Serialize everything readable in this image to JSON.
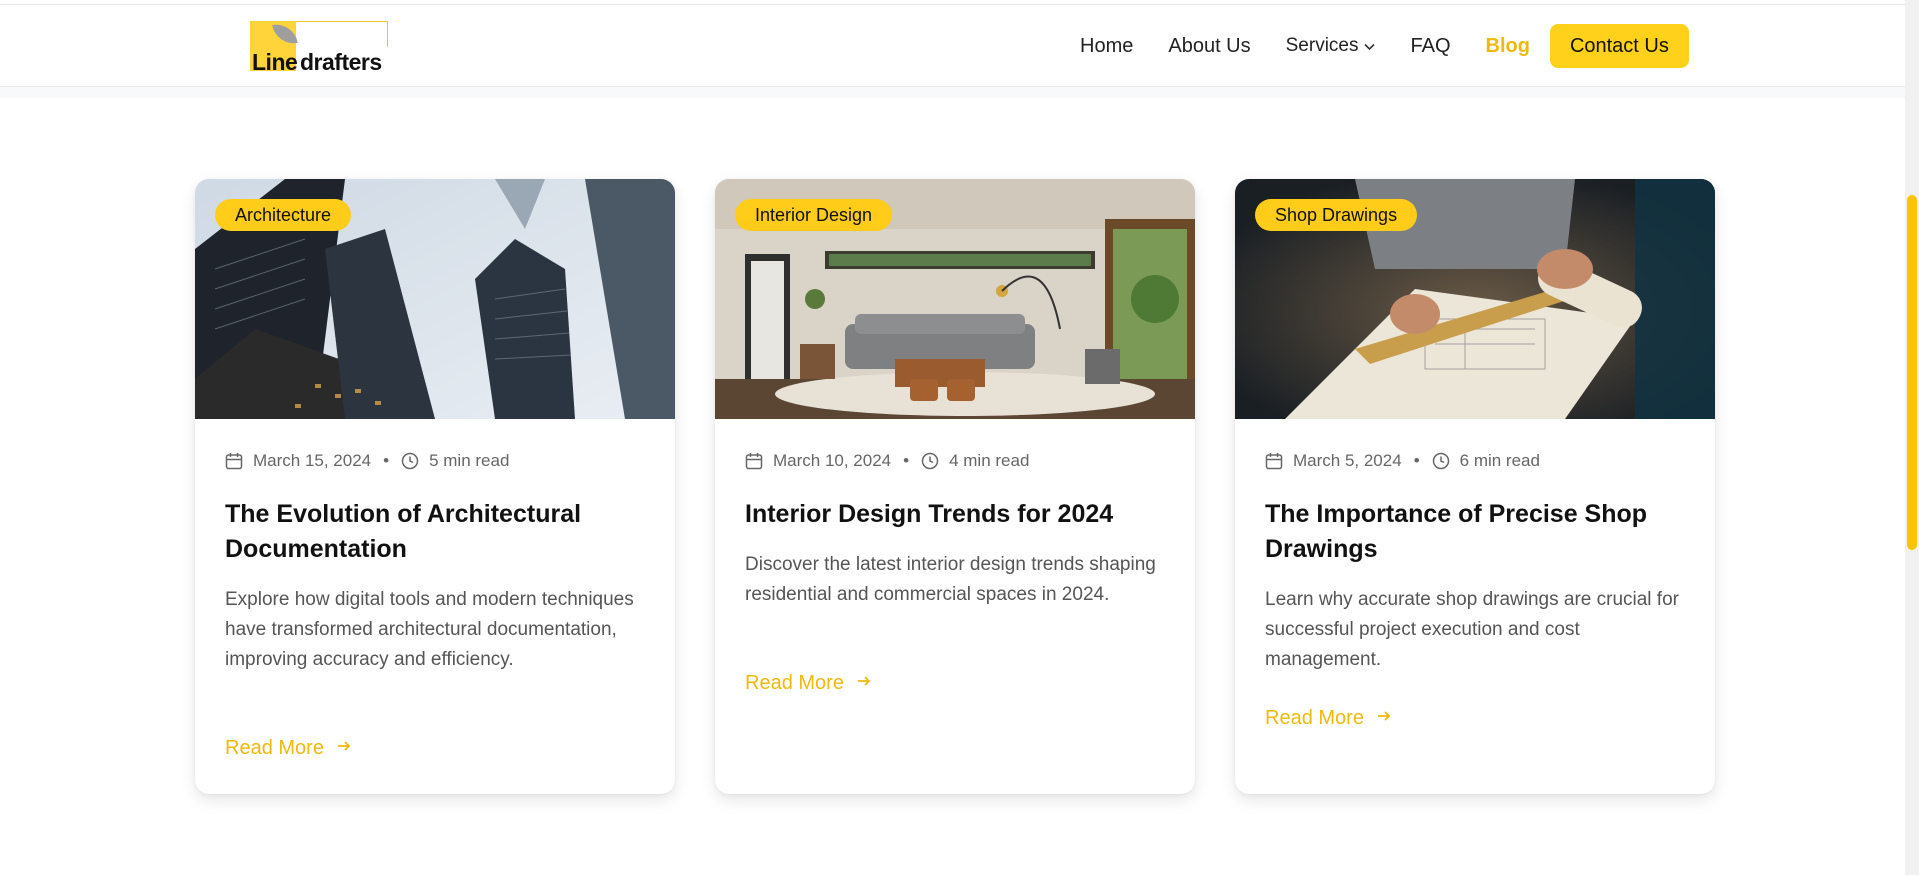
{
  "brand": {
    "logo_word1": "Line",
    "logo_word2": "drafters",
    "accent": "#ffd11a"
  },
  "nav": {
    "home": "Home",
    "about": "About Us",
    "services": "Services",
    "faq": "FAQ",
    "blog": "Blog",
    "contact": "Contact Us"
  },
  "posts": [
    {
      "category": "Architecture",
      "date": "March 15, 2024",
      "read_time": "5 min read",
      "title": "The Evolution of Architectural Documentation",
      "excerpt": "Explore how digital tools and modern techniques have transformed architectural documentation, improving accuracy and efficiency.",
      "cta": "Read More"
    },
    {
      "category": "Interior Design",
      "date": "March 10, 2024",
      "read_time": "4 min read",
      "title": "Interior Design Trends for 2024",
      "excerpt": "Discover the latest interior design trends shaping residential and commercial spaces in 2024.",
      "cta": "Read More"
    },
    {
      "category": "Shop Drawings",
      "date": "March 5, 2024",
      "read_time": "6 min read",
      "title": "The Importance of Precise Shop Drawings",
      "excerpt": "Learn why accurate shop drawings are crucial for successful project execution and cost management.",
      "cta": "Read More"
    }
  ]
}
